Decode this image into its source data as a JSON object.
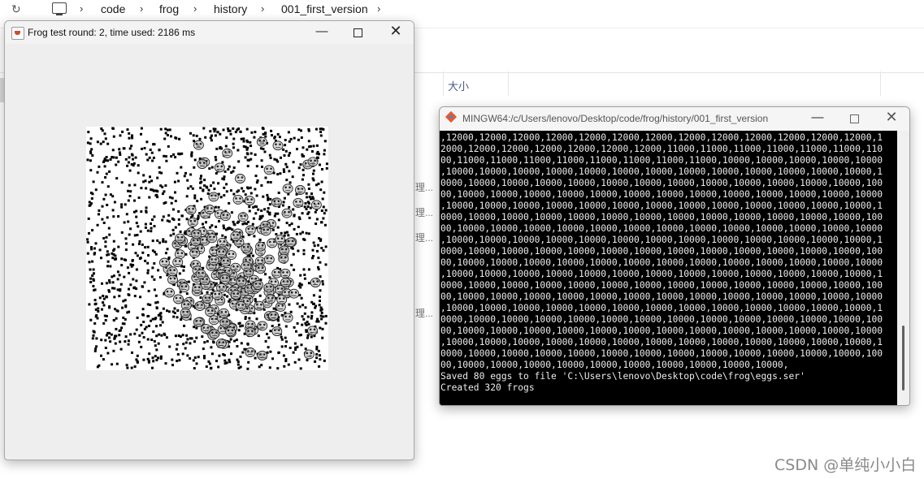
{
  "explorer": {
    "breadcrumb": [
      "code",
      "frog",
      "history",
      "001_first_version"
    ],
    "column_size": "大小",
    "ghost_texts": [
      "理...",
      "理...",
      "理...",
      "理..."
    ]
  },
  "frog_window": {
    "title": "Frog test round: 2, time used: 2186 ms"
  },
  "terminal": {
    "title": "MINGW64:/c/Users/lenovo/Desktop/code/frog/history/001_first_version",
    "lines": [
      ",12000,12000,12000,12000,12000,12000,12000,12000,12000,12000,12000,12000,12000,1",
      "2000,12000,12000,12000,12000,12000,12000,11000,11000,11000,11000,11000,11000,110",
      "00,11000,11000,11000,11000,11000,11000,11000,11000,10000,10000,10000,10000,10000",
      ",10000,10000,10000,10000,10000,10000,10000,10000,10000,10000,10000,10000,10000,1",
      "0000,10000,10000,10000,10000,10000,10000,10000,10000,10000,10000,10000,10000,100",
      "00,10000,10000,10000,10000,10000,10000,10000,10000,10000,10000,10000,10000,10000",
      ",10000,10000,10000,10000,10000,10000,10000,10000,10000,10000,10000,10000,10000,1",
      "0000,10000,10000,10000,10000,10000,10000,10000,10000,10000,10000,10000,10000,100",
      "00,10000,10000,10000,10000,10000,10000,10000,10000,10000,10000,10000,10000,10000",
      ",10000,10000,10000,10000,10000,10000,10000,10000,10000,10000,10000,10000,10000,1",
      "0000,10000,10000,10000,10000,10000,10000,10000,10000,10000,10000,10000,10000,100",
      "00,10000,10000,10000,10000,10000,10000,10000,10000,10000,10000,10000,10000,10000",
      ",10000,10000,10000,10000,10000,10000,10000,10000,10000,10000,10000,10000,10000,1",
      "0000,10000,10000,10000,10000,10000,10000,10000,10000,10000,10000,10000,10000,100",
      "00,10000,10000,10000,10000,10000,10000,10000,10000,10000,10000,10000,10000,10000",
      ",10000,10000,10000,10000,10000,10000,10000,10000,10000,10000,10000,10000,10000,1",
      "0000,10000,10000,10000,10000,10000,10000,10000,10000,10000,10000,10000,10000,100",
      "00,10000,10000,10000,10000,10000,10000,10000,10000,10000,10000,10000,10000,10000",
      ",10000,10000,10000,10000,10000,10000,10000,10000,10000,10000,10000,10000,10000,1",
      "0000,10000,10000,10000,10000,10000,10000,10000,10000,10000,10000,10000,10000,100",
      "00,10000,10000,10000,10000,10000,10000,10000,10000,10000,10000,",
      "Saved 80 eggs to file 'C:\\Users\\lenovo\\Desktop\\code\\frog\\eggs.ser'",
      "Created 320 frogs"
    ]
  },
  "watermark": "CSDN @单纯小小白"
}
